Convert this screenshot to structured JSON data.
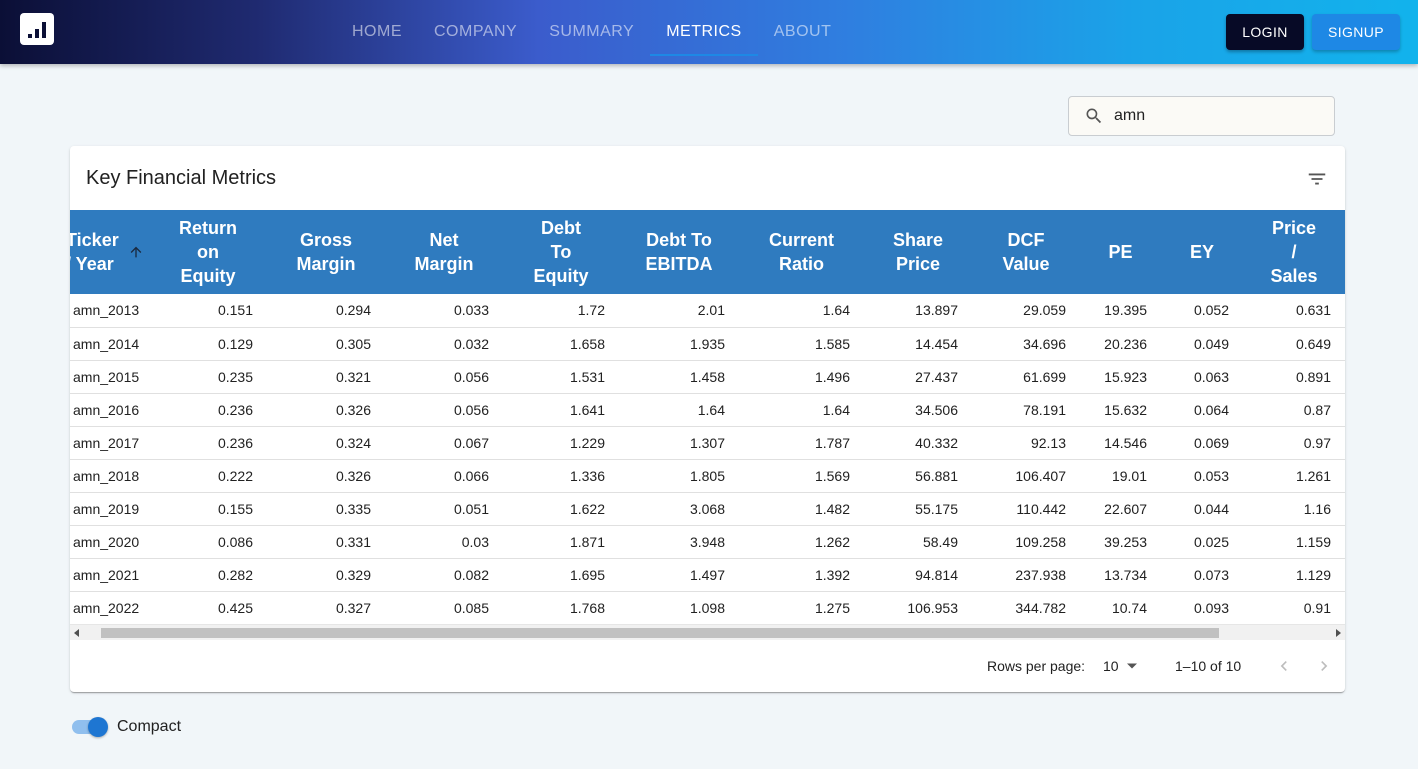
{
  "nav": {
    "items": [
      {
        "label": "HOME",
        "active": false
      },
      {
        "label": "COMPANY",
        "active": false
      },
      {
        "label": "SUMMARY",
        "active": false
      },
      {
        "label": "METRICS",
        "active": true
      },
      {
        "label": "ABOUT",
        "active": false
      }
    ],
    "login_label": "LOGIN",
    "signup_label": "SIGNUP"
  },
  "search": {
    "value": "amn",
    "icon": "search-icon"
  },
  "card": {
    "title": "Key Financial Metrics",
    "filter_icon": "filter-list-icon"
  },
  "table": {
    "columns": [
      {
        "lines": [
          "Ticker",
          "/ Year"
        ],
        "sorted": "asc"
      },
      {
        "lines": [
          "Return",
          "on",
          "Equity"
        ]
      },
      {
        "lines": [
          "Gross",
          "Margin"
        ]
      },
      {
        "lines": [
          "Net",
          "Margin"
        ]
      },
      {
        "lines": [
          "Debt",
          "To",
          "Equity"
        ]
      },
      {
        "lines": [
          "Debt To",
          "EBITDA"
        ]
      },
      {
        "lines": [
          "Current",
          "Ratio"
        ]
      },
      {
        "lines": [
          "Share",
          "Price"
        ]
      },
      {
        "lines": [
          "DCF",
          "Value"
        ]
      },
      {
        "lines": [
          "PE"
        ]
      },
      {
        "lines": [
          "EY"
        ]
      },
      {
        "lines": [
          "Price",
          "/",
          "Sales"
        ]
      }
    ],
    "rows": [
      [
        "amn_2013",
        "0.151",
        "0.294",
        "0.033",
        "1.72",
        "2.01",
        "1.64",
        "13.897",
        "29.059",
        "19.395",
        "0.052",
        "0.631"
      ],
      [
        "amn_2014",
        "0.129",
        "0.305",
        "0.032",
        "1.658",
        "1.935",
        "1.585",
        "14.454",
        "34.696",
        "20.236",
        "0.049",
        "0.649"
      ],
      [
        "amn_2015",
        "0.235",
        "0.321",
        "0.056",
        "1.531",
        "1.458",
        "1.496",
        "27.437",
        "61.699",
        "15.923",
        "0.063",
        "0.891"
      ],
      [
        "amn_2016",
        "0.236",
        "0.326",
        "0.056",
        "1.641",
        "1.64",
        "1.64",
        "34.506",
        "78.191",
        "15.632",
        "0.064",
        "0.87"
      ],
      [
        "amn_2017",
        "0.236",
        "0.324",
        "0.067",
        "1.229",
        "1.307",
        "1.787",
        "40.332",
        "92.13",
        "14.546",
        "0.069",
        "0.97"
      ],
      [
        "amn_2018",
        "0.222",
        "0.326",
        "0.066",
        "1.336",
        "1.805",
        "1.569",
        "56.881",
        "106.407",
        "19.01",
        "0.053",
        "1.261"
      ],
      [
        "amn_2019",
        "0.155",
        "0.335",
        "0.051",
        "1.622",
        "3.068",
        "1.482",
        "55.175",
        "110.442",
        "22.607",
        "0.044",
        "1.16"
      ],
      [
        "amn_2020",
        "0.086",
        "0.331",
        "0.03",
        "1.871",
        "3.948",
        "1.262",
        "58.49",
        "109.258",
        "39.253",
        "0.025",
        "1.159"
      ],
      [
        "amn_2021",
        "0.282",
        "0.329",
        "0.082",
        "1.695",
        "1.497",
        "1.392",
        "94.814",
        "237.938",
        "13.734",
        "0.073",
        "1.129"
      ],
      [
        "amn_2022",
        "0.425",
        "0.327",
        "0.085",
        "1.768",
        "1.098",
        "1.275",
        "106.953",
        "344.782",
        "10.74",
        "0.093",
        "0.91"
      ]
    ]
  },
  "pagination": {
    "rows_per_page_label": "Rows per page:",
    "rows_per_page_value": "10",
    "range_text": "1–10 of 10"
  },
  "compact_toggle": {
    "label": "Compact",
    "checked": true
  },
  "colors": {
    "header_bg": "#2f7bbf",
    "accent": "#1e88e5",
    "login_bg": "#070a26"
  }
}
